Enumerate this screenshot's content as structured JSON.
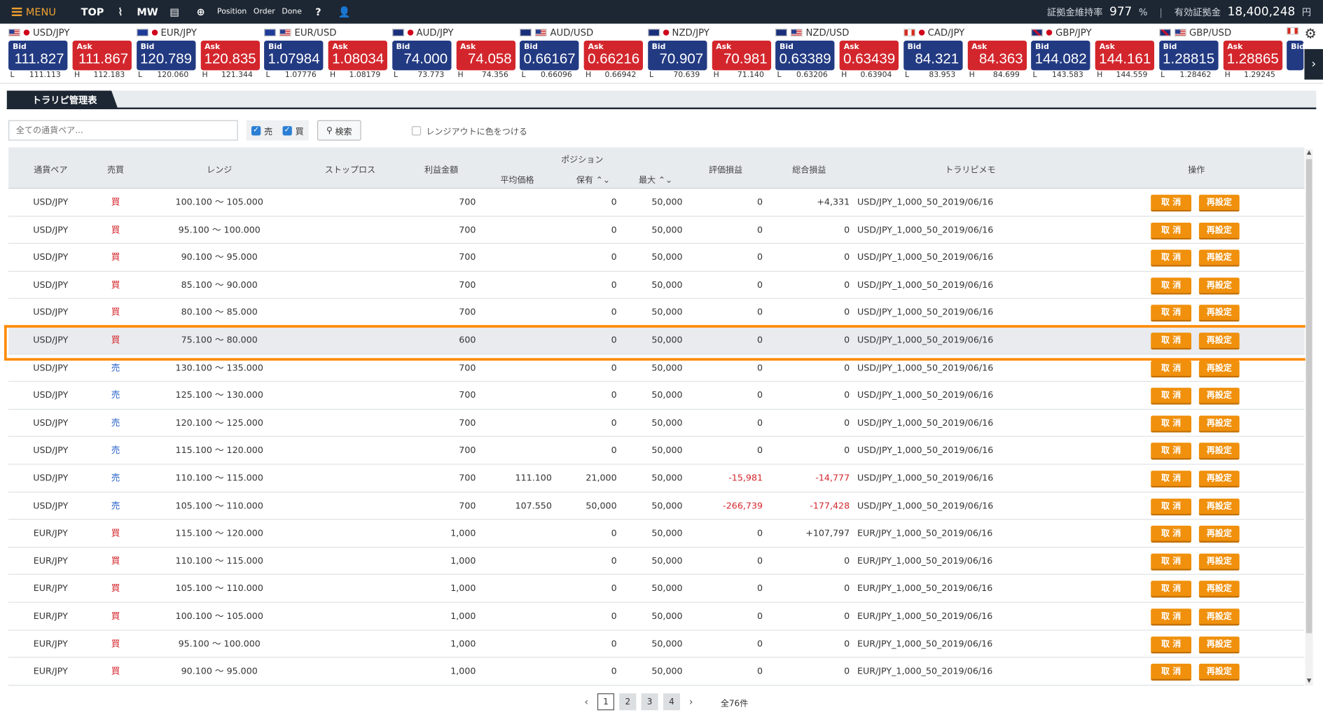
{
  "nav": {
    "menu_label": "MENU",
    "items": [
      {
        "name": "top",
        "label": "TOP"
      },
      {
        "name": "chart",
        "label": "⌇"
      },
      {
        "name": "mw",
        "label": "MW"
      },
      {
        "name": "doc",
        "label": "▤"
      },
      {
        "name": "new-order",
        "label": "⊕"
      },
      {
        "name": "position",
        "label": "Position"
      },
      {
        "name": "order",
        "label": "Order"
      },
      {
        "name": "done",
        "label": "Done"
      },
      {
        "name": "help",
        "label": "?"
      },
      {
        "name": "user",
        "label": "👤"
      }
    ],
    "margin_ratio_label": "証拠金維持率",
    "margin_ratio_value": "977",
    "margin_ratio_unit": "%",
    "equity_label": "有効証拠金",
    "equity_value": "18,400,248",
    "equity_unit": "円"
  },
  "rates": [
    {
      "pair": "USD/JPY",
      "flags": [
        "us",
        "jp"
      ],
      "bid_label": "Bid",
      "bid": "111.827",
      "ask_label": "Ask",
      "ask": "111.867",
      "l": "L",
      "low": "111.113",
      "h": "H",
      "high": "112.183"
    },
    {
      "pair": "EUR/JPY",
      "flags": [
        "eu",
        "jp"
      ],
      "bid_label": "Bid",
      "bid": "120.789",
      "ask_label": "Ask",
      "ask": "120.835",
      "l": "L",
      "low": "120.060",
      "h": "H",
      "high": "121.344"
    },
    {
      "pair": "EUR/USD",
      "flags": [
        "eu",
        "us"
      ],
      "bid_label": "Bid",
      "bid": "1.07984",
      "ask_label": "Ask",
      "ask": "1.08034",
      "l": "L",
      "low": "1.07776",
      "h": "H",
      "high": "1.08179"
    },
    {
      "pair": "AUD/JPY",
      "flags": [
        "au",
        "jp"
      ],
      "bid_label": "Bid",
      "bid": "74.000",
      "ask_label": "Ask",
      "ask": "74.058",
      "l": "L",
      "low": "73.773",
      "h": "H",
      "high": "74.356"
    },
    {
      "pair": "AUD/USD",
      "flags": [
        "au",
        "us"
      ],
      "bid_label": "Bid",
      "bid": "0.66167",
      "ask_label": "Ask",
      "ask": "0.66216",
      "l": "L",
      "low": "0.66096",
      "h": "H",
      "high": "0.66942"
    },
    {
      "pair": "NZD/JPY",
      "flags": [
        "nz",
        "jp"
      ],
      "bid_label": "Bid",
      "bid": "70.907",
      "ask_label": "Ask",
      "ask": "70.981",
      "l": "L",
      "low": "70.639",
      "h": "H",
      "high": "71.140"
    },
    {
      "pair": "NZD/USD",
      "flags": [
        "nz",
        "us"
      ],
      "bid_label": "Bid",
      "bid": "0.63389",
      "ask_label": "Ask",
      "ask": "0.63439",
      "l": "L",
      "low": "0.63206",
      "h": "H",
      "high": "0.63904"
    },
    {
      "pair": "CAD/JPY",
      "flags": [
        "ca",
        "jp"
      ],
      "bid_label": "Bid",
      "bid": "84.321",
      "ask_label": "Ask",
      "ask": "84.363",
      "l": "L",
      "low": "83.953",
      "h": "H",
      "high": "84.699"
    },
    {
      "pair": "GBP/JPY",
      "flags": [
        "gb",
        "jp"
      ],
      "bid_label": "Bid",
      "bid": "144.082",
      "ask_label": "Ask",
      "ask": "144.161",
      "l": "L",
      "low": "143.583",
      "h": "H",
      "high": "144.559"
    },
    {
      "pair": "GBP/USD",
      "flags": [
        "gb",
        "us"
      ],
      "bid_label": "Bid",
      "bid": "1.28815",
      "ask_label": "Ask",
      "ask": "1.28865",
      "l": "L",
      "low": "1.28462",
      "h": "H",
      "high": "1.29245"
    }
  ],
  "next_rate_bid_label": "Bid",
  "tab": {
    "label": "トラリピ管理表"
  },
  "filter": {
    "search_placeholder": "全ての通貨ペア...",
    "sell_label": "売",
    "buy_label": "買",
    "search_button": "検索",
    "color_label": "レンジアウトに色をつける"
  },
  "table": {
    "headers": {
      "pair": "通貨ペア",
      "side": "売買",
      "range": "レンジ",
      "stoploss": "ストップロス",
      "profit": "利益金額",
      "position": "ポジション",
      "avg": "平均価格",
      "hold": "保有 ⌃⌄",
      "max": "最大 ⌃⌄",
      "eval": "評価損益",
      "total": "総合損益",
      "memo": "トラリピメモ",
      "ops": "操作"
    },
    "cancel_label": "取 消",
    "reset_label": "再設定",
    "rows": [
      {
        "pair": "USD/JPY",
        "side": "買",
        "dir": "buy",
        "range": "100.100 ～ 105.000",
        "profit": "700",
        "avg": "",
        "hold": "0",
        "max": "50,000",
        "eval": "0",
        "total": "+4,331",
        "memo": "USD/JPY_1,000_50_2019/06/16"
      },
      {
        "pair": "USD/JPY",
        "side": "買",
        "dir": "buy",
        "range": "95.100 ～ 100.000",
        "profit": "700",
        "avg": "",
        "hold": "0",
        "max": "50,000",
        "eval": "0",
        "total": "0",
        "memo": "USD/JPY_1,000_50_2019/06/16"
      },
      {
        "pair": "USD/JPY",
        "side": "買",
        "dir": "buy",
        "range": "90.100 ～ 95.000",
        "profit": "700",
        "avg": "",
        "hold": "0",
        "max": "50,000",
        "eval": "0",
        "total": "0",
        "memo": "USD/JPY_1,000_50_2019/06/16"
      },
      {
        "pair": "USD/JPY",
        "side": "買",
        "dir": "buy",
        "range": "85.100 ～ 90.000",
        "profit": "700",
        "avg": "",
        "hold": "0",
        "max": "50,000",
        "eval": "0",
        "total": "0",
        "memo": "USD/JPY_1,000_50_2019/06/16"
      },
      {
        "pair": "USD/JPY",
        "side": "買",
        "dir": "buy",
        "range": "80.100 ～ 85.000",
        "profit": "700",
        "avg": "",
        "hold": "0",
        "max": "50,000",
        "eval": "0",
        "total": "0",
        "memo": "USD/JPY_1,000_50_2019/06/16"
      },
      {
        "pair": "USD/JPY",
        "side": "買",
        "dir": "buy",
        "range": "75.100 ～ 80.000",
        "profit": "600",
        "avg": "",
        "hold": "0",
        "max": "50,000",
        "eval": "0",
        "total": "0",
        "memo": "USD/JPY_1,000_50_2019/06/16",
        "highlight": true
      },
      {
        "pair": "USD/JPY",
        "side": "売",
        "dir": "sell",
        "range": "130.100 ～ 135.000",
        "profit": "700",
        "avg": "",
        "hold": "0",
        "max": "50,000",
        "eval": "0",
        "total": "0",
        "memo": "USD/JPY_1,000_50_2019/06/16"
      },
      {
        "pair": "USD/JPY",
        "side": "売",
        "dir": "sell",
        "range": "125.100 ～ 130.000",
        "profit": "700",
        "avg": "",
        "hold": "0",
        "max": "50,000",
        "eval": "0",
        "total": "0",
        "memo": "USD/JPY_1,000_50_2019/06/16"
      },
      {
        "pair": "USD/JPY",
        "side": "売",
        "dir": "sell",
        "range": "120.100 ～ 125.000",
        "profit": "700",
        "avg": "",
        "hold": "0",
        "max": "50,000",
        "eval": "0",
        "total": "0",
        "memo": "USD/JPY_1,000_50_2019/06/16"
      },
      {
        "pair": "USD/JPY",
        "side": "売",
        "dir": "sell",
        "range": "115.100 ～ 120.000",
        "profit": "700",
        "avg": "",
        "hold": "0",
        "max": "50,000",
        "eval": "0",
        "total": "0",
        "memo": "USD/JPY_1,000_50_2019/06/16"
      },
      {
        "pair": "USD/JPY",
        "side": "売",
        "dir": "sell",
        "range": "110.100 ～ 115.000",
        "profit": "700",
        "avg": "111.100",
        "hold": "21,000",
        "max": "50,000",
        "eval": "-15,981",
        "total": "-14,777",
        "memo": "USD/JPY_1,000_50_2019/06/16"
      },
      {
        "pair": "USD/JPY",
        "side": "売",
        "dir": "sell",
        "range": "105.100 ～ 110.000",
        "profit": "700",
        "avg": "107.550",
        "hold": "50,000",
        "max": "50,000",
        "eval": "-266,739",
        "total": "-177,428",
        "memo": "USD/JPY_1,000_50_2019/06/16"
      },
      {
        "pair": "EUR/JPY",
        "side": "買",
        "dir": "buy",
        "range": "115.100 ～ 120.000",
        "profit": "1,000",
        "avg": "",
        "hold": "0",
        "max": "50,000",
        "eval": "0",
        "total": "+107,797",
        "memo": "EUR/JPY_1,000_50_2019/06/16"
      },
      {
        "pair": "EUR/JPY",
        "side": "買",
        "dir": "buy",
        "range": "110.100 ～ 115.000",
        "profit": "1,000",
        "avg": "",
        "hold": "0",
        "max": "50,000",
        "eval": "0",
        "total": "0",
        "memo": "EUR/JPY_1,000_50_2019/06/16"
      },
      {
        "pair": "EUR/JPY",
        "side": "買",
        "dir": "buy",
        "range": "105.100 ～ 110.000",
        "profit": "1,000",
        "avg": "",
        "hold": "0",
        "max": "50,000",
        "eval": "0",
        "total": "0",
        "memo": "EUR/JPY_1,000_50_2019/06/16"
      },
      {
        "pair": "EUR/JPY",
        "side": "買",
        "dir": "buy",
        "range": "100.100 ～ 105.000",
        "profit": "1,000",
        "avg": "",
        "hold": "0",
        "max": "50,000",
        "eval": "0",
        "total": "0",
        "memo": "EUR/JPY_1,000_50_2019/06/16"
      },
      {
        "pair": "EUR/JPY",
        "side": "買",
        "dir": "buy",
        "range": "95.100 ～ 100.000",
        "profit": "1,000",
        "avg": "",
        "hold": "0",
        "max": "50,000",
        "eval": "0",
        "total": "0",
        "memo": "EUR/JPY_1,000_50_2019/06/16"
      },
      {
        "pair": "EUR/JPY",
        "side": "買",
        "dir": "buy",
        "range": "90.100 ～ 95.000",
        "profit": "1,000",
        "avg": "",
        "hold": "0",
        "max": "50,000",
        "eval": "0",
        "total": "0",
        "memo": "EUR/JPY_1,000_50_2019/06/16"
      }
    ]
  },
  "pager": {
    "pages": [
      "1",
      "2",
      "3",
      "4"
    ],
    "current": "1",
    "prev": "‹",
    "next": "›",
    "total": "全76件"
  },
  "colors": {
    "nav_bg": "#1d2733",
    "bid": "#223a82",
    "ask": "#d3262c",
    "button": "#f0900c",
    "highlight": "#ff8a00"
  }
}
